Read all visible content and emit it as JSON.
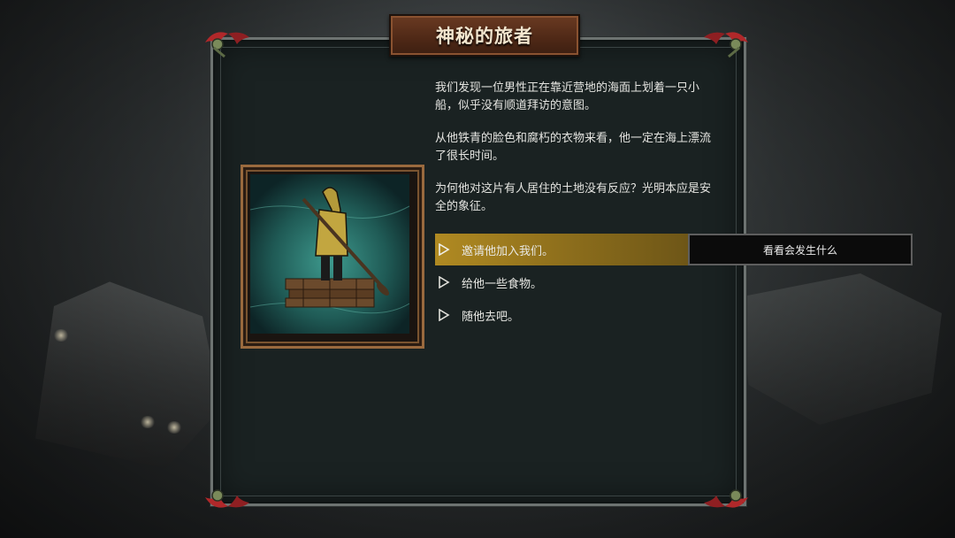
{
  "event": {
    "title": "神秘的旅者",
    "description": [
      "我们发现一位男性正在靠近营地的海面上划着一只小船，似乎没有顺道拜访的意图。",
      "从他铁青的脸色和腐朽的衣物来看，他一定在海上漂流了很长时间。",
      "为何他对这片有人居住的土地没有反应？光明本应是安全的象征。"
    ],
    "portrait": {
      "subject": "hooded-raftsman-on-raft",
      "icon": "raftsman-portrait"
    },
    "options": [
      {
        "label": "邀请他加入我们。",
        "selected": true,
        "icon": "play-triangle-icon"
      },
      {
        "label": "给他一些食物。",
        "selected": false,
        "icon": "play-triangle-icon"
      },
      {
        "label": "随他去吧。",
        "selected": false,
        "icon": "play-triangle-icon"
      }
    ],
    "tooltip": "看看会发生什么"
  },
  "colors": {
    "panel_bg": "#1a2222",
    "title_plate": "#5a2f1b",
    "selected_option": "#b08a22",
    "frame_gold": "#9a6a3e",
    "corner_ornament_red": "#b0282a"
  }
}
